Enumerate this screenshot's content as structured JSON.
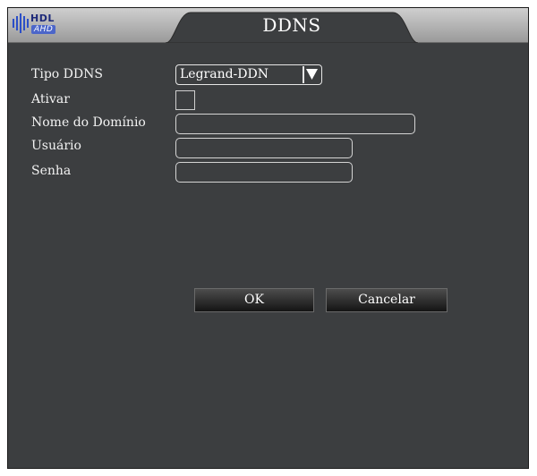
{
  "window": {
    "title": "DDNS"
  },
  "logo": {
    "brand": "HDL",
    "sub": "AHD"
  },
  "form": {
    "ddns_type": {
      "label": "Tipo DDNS",
      "value": "Legrand-DDN"
    },
    "enable": {
      "label": "Ativar"
    },
    "domain": {
      "label": "Nome do Domínio",
      "value": ""
    },
    "user": {
      "label": "Usuário",
      "value": ""
    },
    "password": {
      "label": "Senha",
      "value": ""
    }
  },
  "buttons": {
    "ok": "OK",
    "cancel": "Cancelar"
  },
  "icons": {
    "dropdown": "chevron-down-icon",
    "logo": "hdl-logo-icon"
  }
}
